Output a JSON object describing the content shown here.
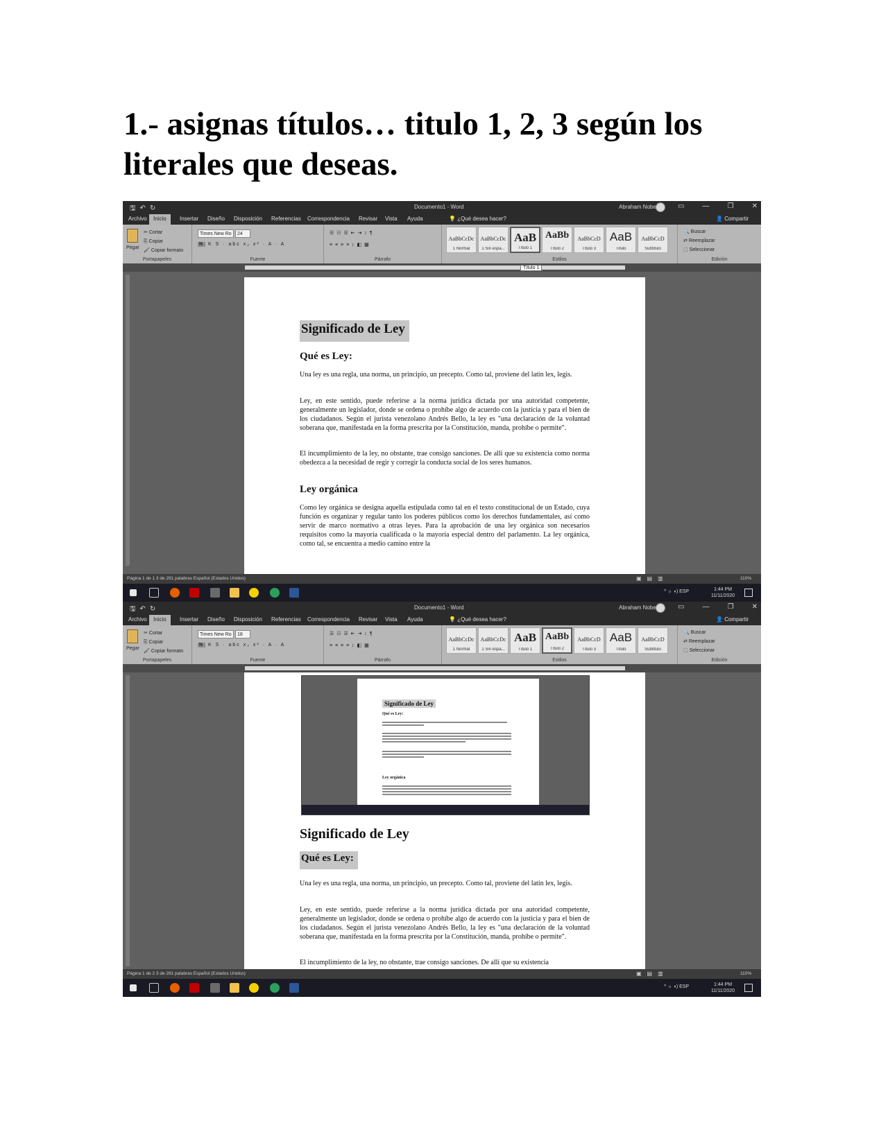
{
  "heading": "1.- asignas títulos… titulo 1, 2, 3 según los literales que deseas.",
  "word": {
    "doc_title": "Documento1 - Word",
    "user": "Abraham Nobe",
    "tabs": [
      "Archivo",
      "Inicio",
      "Insertar",
      "Diseño",
      "Disposición",
      "Referencias",
      "Correspondencia",
      "Revisar",
      "Vista",
      "Ayuda"
    ],
    "tell_me": "¿Qué desea hacer?",
    "share": "Compartir",
    "clipboard": {
      "paste": "Pegar",
      "cut": "Cortar",
      "copy": "Copiar",
      "format_painter": "Copiar formato",
      "label": "Portapapeles"
    },
    "font": {
      "name": "Times New Ro",
      "size": "24",
      "size_2": "18",
      "label": "Fuente"
    },
    "paragraph_label": "Párrafo",
    "styles": [
      {
        "preview": "AaBbCcDc",
        "name": "1 Normal"
      },
      {
        "preview": "AaBbCcDc",
        "name": "1 Sin espa..."
      },
      {
        "preview": "AaB",
        "name": "Título 1"
      },
      {
        "preview": "AaBb",
        "name": "Título 2"
      },
      {
        "preview": "AaBbCcD",
        "name": "Título 3"
      },
      {
        "preview": "AaB",
        "name": "Título"
      },
      {
        "preview": "AaBbCcD",
        "name": "Subtítulo"
      }
    ],
    "styles_label": "Estilos",
    "editing": {
      "find": "Buscar",
      "replace": "Reemplazar",
      "select": "Seleccionar",
      "label": "Edición"
    },
    "tooltip": "Título 1",
    "status_1": "Página 1 de 1     3 de 291 palabras     Español (Estados Unidos)",
    "status_2": "Página 1 de 2     3 de 291 palabras     Español (Estados Unidos)",
    "zoom": "110%",
    "tray": "ESP",
    "time": "1:44 PM",
    "date": "11/11/2020"
  },
  "document": {
    "title": "Significado de Ley",
    "subtitle": "Qué es Ley:",
    "p1": "Una ley es una regla, una norma, un principio, un precepto. Como tal, proviene del latín lex, legis.",
    "p2": "Ley, en este sentido, puede referirse a la norma jurídica dictada por una autoridad competente, generalmente un legislador, donde se ordena o prohíbe algo de acuerdo con la justicia y para el bien de los ciudadanos. Según el jurista venezolano Andrés Bello, la ley es \"una declaración de la voluntad soberana que, manifestada en la forma prescrita por la Constitución, manda, prohíbe o permite\".",
    "p3": "El incumplimiento de la ley, no obstante, trae consigo sanciones. De allí que su existencia como norma obedezca a la necesidad de regir y corregir la conducta social de los seres humanos.",
    "section": "Ley orgánica",
    "p4": "Como ley orgánica se designa aquella estipulada como tal en el texto constitucional de un Estado, cuya función es organizar y regular tanto los poderes públicos como los derechos fundamentales, así como servir de marco normativo a otras leyes. Para la aprobación de una ley orgánica son necesarios requisitos como la mayoría cualificada o la mayoría especial dentro del parlamento. La ley orgánica, como tal, se encuentra a medio camino entre la",
    "p3_start": "El incumplimiento de la ley, no obstante, trae consigo sanciones. De allí que su existencia"
  },
  "colors": {
    "ribbon": "#b7b7b7",
    "titlebar": "#2b2b2b",
    "canvas": "#606060",
    "highlight": "#c6c6c6"
  }
}
